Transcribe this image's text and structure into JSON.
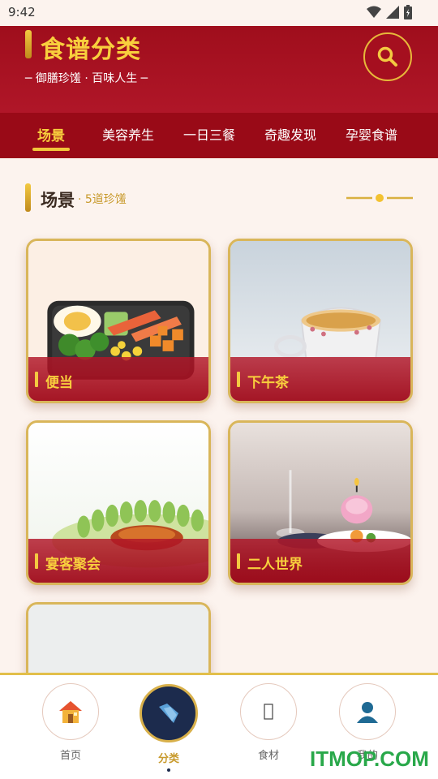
{
  "status_bar": {
    "time": "9:42"
  },
  "header": {
    "title": "食谱分类",
    "subtitle": "─ 御膳珍馐 · 百味人生 ─"
  },
  "tabs": [
    {
      "label": "场景",
      "active": true
    },
    {
      "label": "美容养生"
    },
    {
      "label": "一日三餐"
    },
    {
      "label": "奇趣发现"
    },
    {
      "label": "孕婴食谱"
    }
  ],
  "section": {
    "title": "场景",
    "count": "· 5道珍馐"
  },
  "cards": [
    {
      "label": "便当"
    },
    {
      "label": "下午茶"
    },
    {
      "label": "宴客聚会"
    },
    {
      "label": "二人世界"
    },
    {
      "label": ""
    }
  ],
  "bottom_nav": [
    {
      "label": "首页",
      "icon": "house-icon"
    },
    {
      "label": "分类",
      "icon": "category-icon",
      "active": true
    },
    {
      "label": "食材",
      "icon": "ingredients-icon"
    },
    {
      "label": "我的",
      "icon": "profile-icon"
    }
  ],
  "watermark": "ITMOP.COM",
  "colors": {
    "header_red": "#a50f1f",
    "gold": "#f8cf3d",
    "nav_navy": "#1c2b4d"
  }
}
